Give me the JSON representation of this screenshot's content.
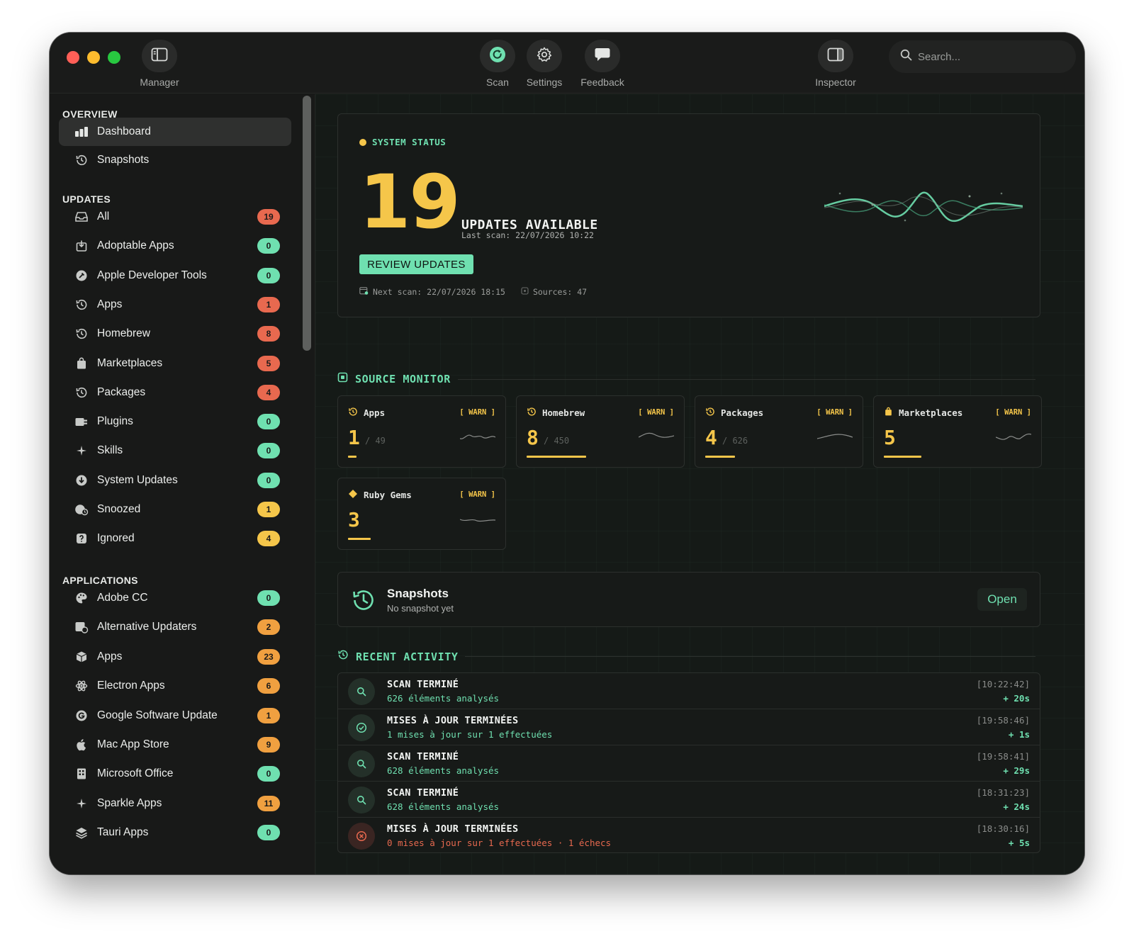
{
  "toolbar": {
    "manager_label": "Manager",
    "scan_label": "Scan",
    "settings_label": "Settings",
    "feedback_label": "Feedback",
    "inspector_label": "Inspector",
    "search_placeholder": "Search..."
  },
  "sidebar": {
    "overview_header": "OVERVIEW",
    "overview_items": [
      {
        "label": "Dashboard",
        "icon": "bar-chart-icon",
        "active": true
      },
      {
        "label": "Snapshots",
        "icon": "clock-history-icon"
      }
    ],
    "updates_header": "UPDATES",
    "updates_items": [
      {
        "label": "All",
        "count": "19",
        "color": "red"
      },
      {
        "label": "Adoptable Apps",
        "count": "0",
        "color": "green"
      },
      {
        "label": "Apple Developer Tools",
        "count": "0",
        "color": "green"
      },
      {
        "label": "Apps",
        "count": "1",
        "color": "red"
      },
      {
        "label": "Homebrew",
        "count": "8",
        "color": "red"
      },
      {
        "label": "Marketplaces",
        "count": "5",
        "color": "red"
      },
      {
        "label": "Packages",
        "count": "4",
        "color": "red"
      },
      {
        "label": "Plugins",
        "count": "0",
        "color": "green"
      },
      {
        "label": "Skills",
        "count": "0",
        "color": "green"
      },
      {
        "label": "System Updates",
        "count": "0",
        "color": "green"
      },
      {
        "label": "Snoozed",
        "count": "1",
        "color": "yellow"
      },
      {
        "label": "Ignored",
        "count": "4",
        "color": "yellow"
      }
    ],
    "applications_header": "APPLICATIONS",
    "applications_items": [
      {
        "label": "Adobe CC",
        "count": "0",
        "color": "green"
      },
      {
        "label": "Alternative Updaters",
        "count": "2",
        "color": "orange"
      },
      {
        "label": "Apps",
        "count": "23",
        "color": "orange"
      },
      {
        "label": "Electron Apps",
        "count": "6",
        "color": "orange"
      },
      {
        "label": "Google Software Update",
        "count": "1",
        "color": "orange"
      },
      {
        "label": "Mac App Store",
        "count": "9",
        "color": "orange"
      },
      {
        "label": "Microsoft Office",
        "count": "0",
        "color": "green"
      },
      {
        "label": "Sparkle Apps",
        "count": "11",
        "color": "orange"
      },
      {
        "label": "Tauri Apps",
        "count": "0",
        "color": "green"
      }
    ]
  },
  "status": {
    "title": "SYSTEM STATUS",
    "count": "19",
    "label": "UPDATES AVAILABLE",
    "last_scan": "Last scan: 22/07/2026 10:22",
    "review_button": "REVIEW UPDATES",
    "next_scan": "Next scan: 22/07/2026 18:15",
    "sources": "Sources: 47"
  },
  "source_monitor": {
    "title": "SOURCE MONITOR",
    "cards": [
      {
        "name": "Apps",
        "value": "1",
        "total": "/ 49",
        "status": "[ WARN ]",
        "fill": 0.05
      },
      {
        "name": "Homebrew",
        "value": "8",
        "total": "/ 450",
        "status": "[ WARN ]",
        "fill": 0.4
      },
      {
        "name": "Packages",
        "value": "4",
        "total": "/ 626",
        "status": "[ WARN ]",
        "fill": 0.2
      },
      {
        "name": "Marketplaces",
        "value": "5",
        "total": "",
        "status": "[ WARN ]",
        "fill": 0.25
      },
      {
        "name": "Ruby Gems",
        "value": "3",
        "total": "",
        "status": "[ WARN ]",
        "fill": 0.15
      }
    ]
  },
  "snapshots": {
    "title": "Snapshots",
    "subtitle": "No snapshot yet",
    "open_button": "Open"
  },
  "recent_activity": {
    "title": "RECENT ACTIVITY",
    "rows": [
      {
        "title": "SCAN TERMINÉ",
        "subtitle": "626 éléments analysés",
        "time": "[10:22:42]",
        "duration": "+ 20s",
        "kind": "scan"
      },
      {
        "title": "MISES À JOUR TERMINÉES",
        "subtitle": "1 mises à jour sur 1 effectuées",
        "time": "[19:58:46]",
        "duration": "+ 1s",
        "kind": "success"
      },
      {
        "title": "SCAN TERMINÉ",
        "subtitle": "628 éléments analysés",
        "time": "[19:58:41]",
        "duration": "+ 29s",
        "kind": "scan"
      },
      {
        "title": "SCAN TERMINÉ",
        "subtitle": "628 éléments analysés",
        "time": "[18:31:23]",
        "duration": "+ 24s",
        "kind": "scan"
      },
      {
        "title": "MISES À JOUR TERMINÉES",
        "subtitle": "0 mises à jour sur 1 effectuées · 1 échecs",
        "time": "[18:30:16]",
        "duration": "+ 5s",
        "kind": "error"
      }
    ]
  },
  "colors": {
    "accent": "#6fe0b0",
    "warning": "#f5c64a",
    "danger": "#e8694f",
    "orange": "#f0a040"
  }
}
